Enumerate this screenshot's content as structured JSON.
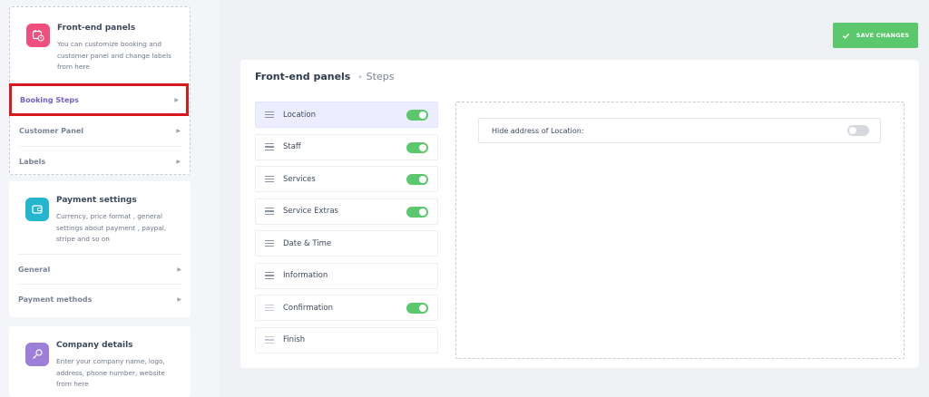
{
  "toolbar": {
    "save_label": "SAVE CHANGES"
  },
  "sidebar": {
    "frontend": {
      "title": "Front-end panels",
      "desc": "You can customize booking and customer panel and change labels from here",
      "active_item": "Booking Steps",
      "items": [
        "Customer Panel",
        "Labels"
      ]
    },
    "payment": {
      "title": "Payment settings",
      "desc": "Currency, price format , general settings about payment , paypal, stripe and so on",
      "items": [
        "General",
        "Payment methods"
      ]
    },
    "company": {
      "title": "Company details",
      "desc": "Enter your company name, logo, address, phone number, website from here"
    }
  },
  "panel": {
    "title": "Front-end panels",
    "separator": "•",
    "subtitle": "Steps",
    "steps": [
      {
        "label": "Location",
        "toggle": true,
        "selected": true
      },
      {
        "label": "Staff",
        "toggle": true
      },
      {
        "label": "Services",
        "toggle": true
      },
      {
        "label": "Service Extras",
        "toggle": true
      },
      {
        "label": "Date & Time",
        "toggle": null
      },
      {
        "label": "Information",
        "toggle": null
      },
      {
        "label": "Confirmation",
        "toggle": true
      },
      {
        "label": "Finish",
        "toggle": null
      }
    ],
    "setting": {
      "label": "Hide address of Location:",
      "toggle": false
    }
  },
  "colors": {
    "accent_green": "#5bc86d",
    "highlight_red": "#d7191c",
    "active_purple": "#6e63c7",
    "icon_pink": "#ee4f7d",
    "icon_teal": "#26b5cf",
    "icon_violet": "#9b7fd8"
  },
  "icons": {
    "frontend": "calendar-clock-icon",
    "payment": "wallet-icon",
    "company": "key-icon",
    "save": "check-icon",
    "menu_caret": "caret-right-icon",
    "step_handle": "drag-handle-icon"
  }
}
